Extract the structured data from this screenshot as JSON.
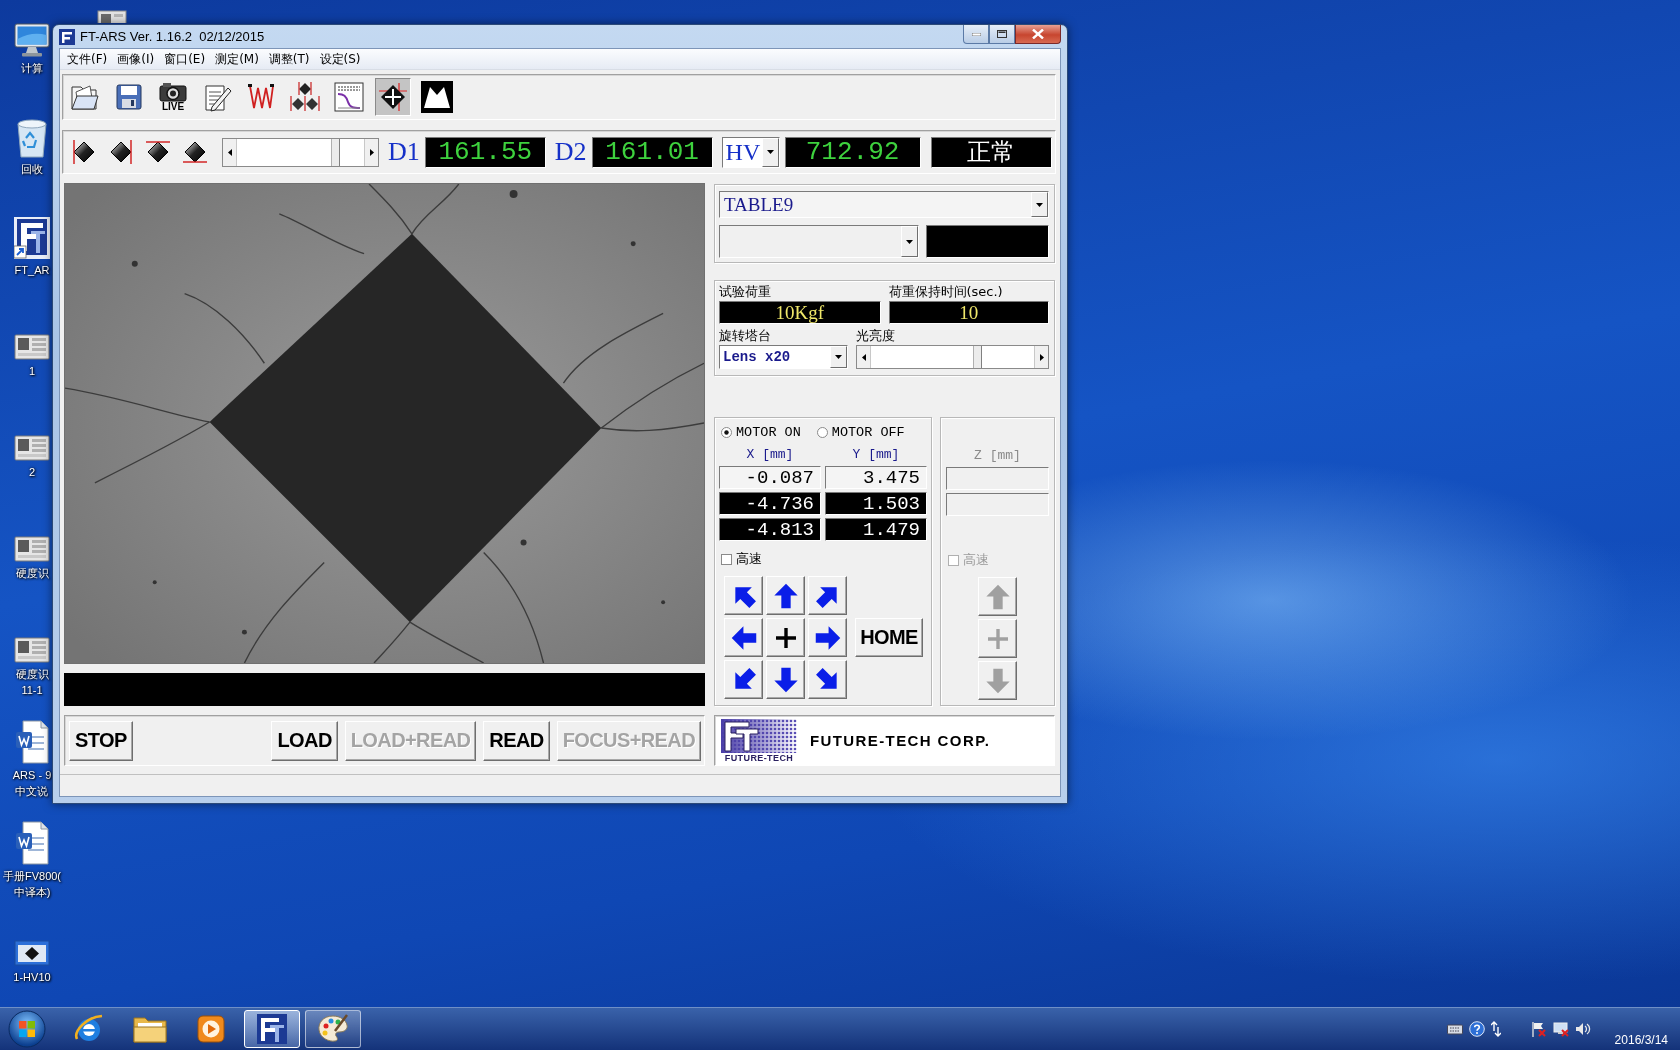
{
  "desktop": {
    "icons": [
      {
        "kind": "computer",
        "lines": [
          "计算"
        ]
      },
      {
        "kind": "recycle_bin",
        "lines": [
          "回收"
        ]
      },
      {
        "kind": "app",
        "lines": [
          "FT_AR"
        ]
      },
      {
        "kind": "device",
        "lines": [
          "1"
        ]
      },
      {
        "kind": "device",
        "lines": [
          "2"
        ]
      },
      {
        "kind": "device",
        "lines": [
          "硬度识"
        ]
      },
      {
        "kind": "device",
        "lines": [
          "硬度识",
          "11-1"
        ]
      },
      {
        "kind": "document",
        "lines": [
          "ARS - 9",
          "中文说"
        ]
      },
      {
        "kind": "document",
        "lines": [
          "手册FV800(",
          "中译本)"
        ]
      },
      {
        "kind": "camera",
        "lines": [
          "1-HV10"
        ]
      }
    ]
  },
  "window": {
    "title": "FT-ARS Ver. 1.16.2  02/12/2015"
  },
  "menu": [
    "文件(F)",
    "画像(I)",
    "窗口(E)",
    "测定(M)",
    "调整(T)",
    "设定(S)"
  ],
  "toolbar": [
    {
      "kind": "open",
      "selected": false
    },
    {
      "kind": "save",
      "selected": false
    },
    {
      "kind": "live",
      "text": "LIVE",
      "selected": false
    },
    {
      "kind": "notes",
      "selected": false
    },
    {
      "kind": "zigzag",
      "selected": false
    },
    {
      "kind": "measure",
      "selected": false
    },
    {
      "kind": "curve",
      "selected": false
    },
    {
      "kind": "crosshair",
      "selected": true
    },
    {
      "kind": "peaks",
      "selected": false
    }
  ],
  "measure_bar": {
    "edges": [
      {
        "kind": "left"
      },
      {
        "kind": "right"
      },
      {
        "kind": "top"
      },
      {
        "kind": "bottom"
      }
    ],
    "slider": {
      "level": 0.8
    },
    "readouts": [
      {
        "label": "D1",
        "value": "161.55"
      },
      {
        "label": "D2",
        "value": "161.01"
      }
    ],
    "hv": {
      "label": "HV",
      "value": "712.92"
    },
    "status": "正常"
  },
  "table": {
    "value": "TABLE9"
  },
  "test": {
    "load_label": "试验荷重",
    "load_value": "10Kgf",
    "dwell_label": "荷重保持时间(sec.)",
    "dwell_value": "10",
    "turret_label": "旋转塔台",
    "turret_value": "Lens x20",
    "brightness_label": "光亮度",
    "brightness": {
      "level": 0.66
    }
  },
  "motor": {
    "options": [
      {
        "label": "MOTOR ON",
        "selected": true
      },
      {
        "label": "MOTOR OFF",
        "selected": false
      }
    ],
    "columns": [
      "X [mm]",
      "Y [mm]"
    ],
    "rows": [
      {
        "kind": "input",
        "cells": [
          "-0.087",
          "3.475"
        ]
      },
      {
        "kind": "display",
        "cells": [
          "-4.736",
          "1.503"
        ]
      },
      {
        "kind": "display",
        "cells": [
          "-4.813",
          "1.479"
        ]
      }
    ],
    "fast": {
      "label": "高速",
      "checked": false
    },
    "home": "HOME"
  },
  "z_axis": {
    "column": "Z [mm]",
    "disabled": true,
    "fast": {
      "label": "高速",
      "checked": false
    }
  },
  "actions": [
    {
      "label": "STOP",
      "disabled": false
    },
    {
      "label": "LOAD",
      "disabled": false
    },
    {
      "label": "LOAD+READ",
      "disabled": true
    },
    {
      "label": "READ",
      "disabled": false
    },
    {
      "label": "FOCUS+READ",
      "disabled": true
    }
  ],
  "logo": {
    "mark": "FUTURE-TECH",
    "company": "FUTURE-TECH CORP."
  },
  "taskbar": {
    "apps": [
      {
        "kind": "browser",
        "running": false,
        "selected": false
      },
      {
        "kind": "folder",
        "running": false,
        "selected": false
      },
      {
        "kind": "media",
        "running": false,
        "selected": false
      },
      {
        "kind": "ft",
        "running": true,
        "selected": true
      },
      {
        "kind": "paint",
        "running": true,
        "selected": false
      }
    ],
    "date": "2016/3/14"
  }
}
